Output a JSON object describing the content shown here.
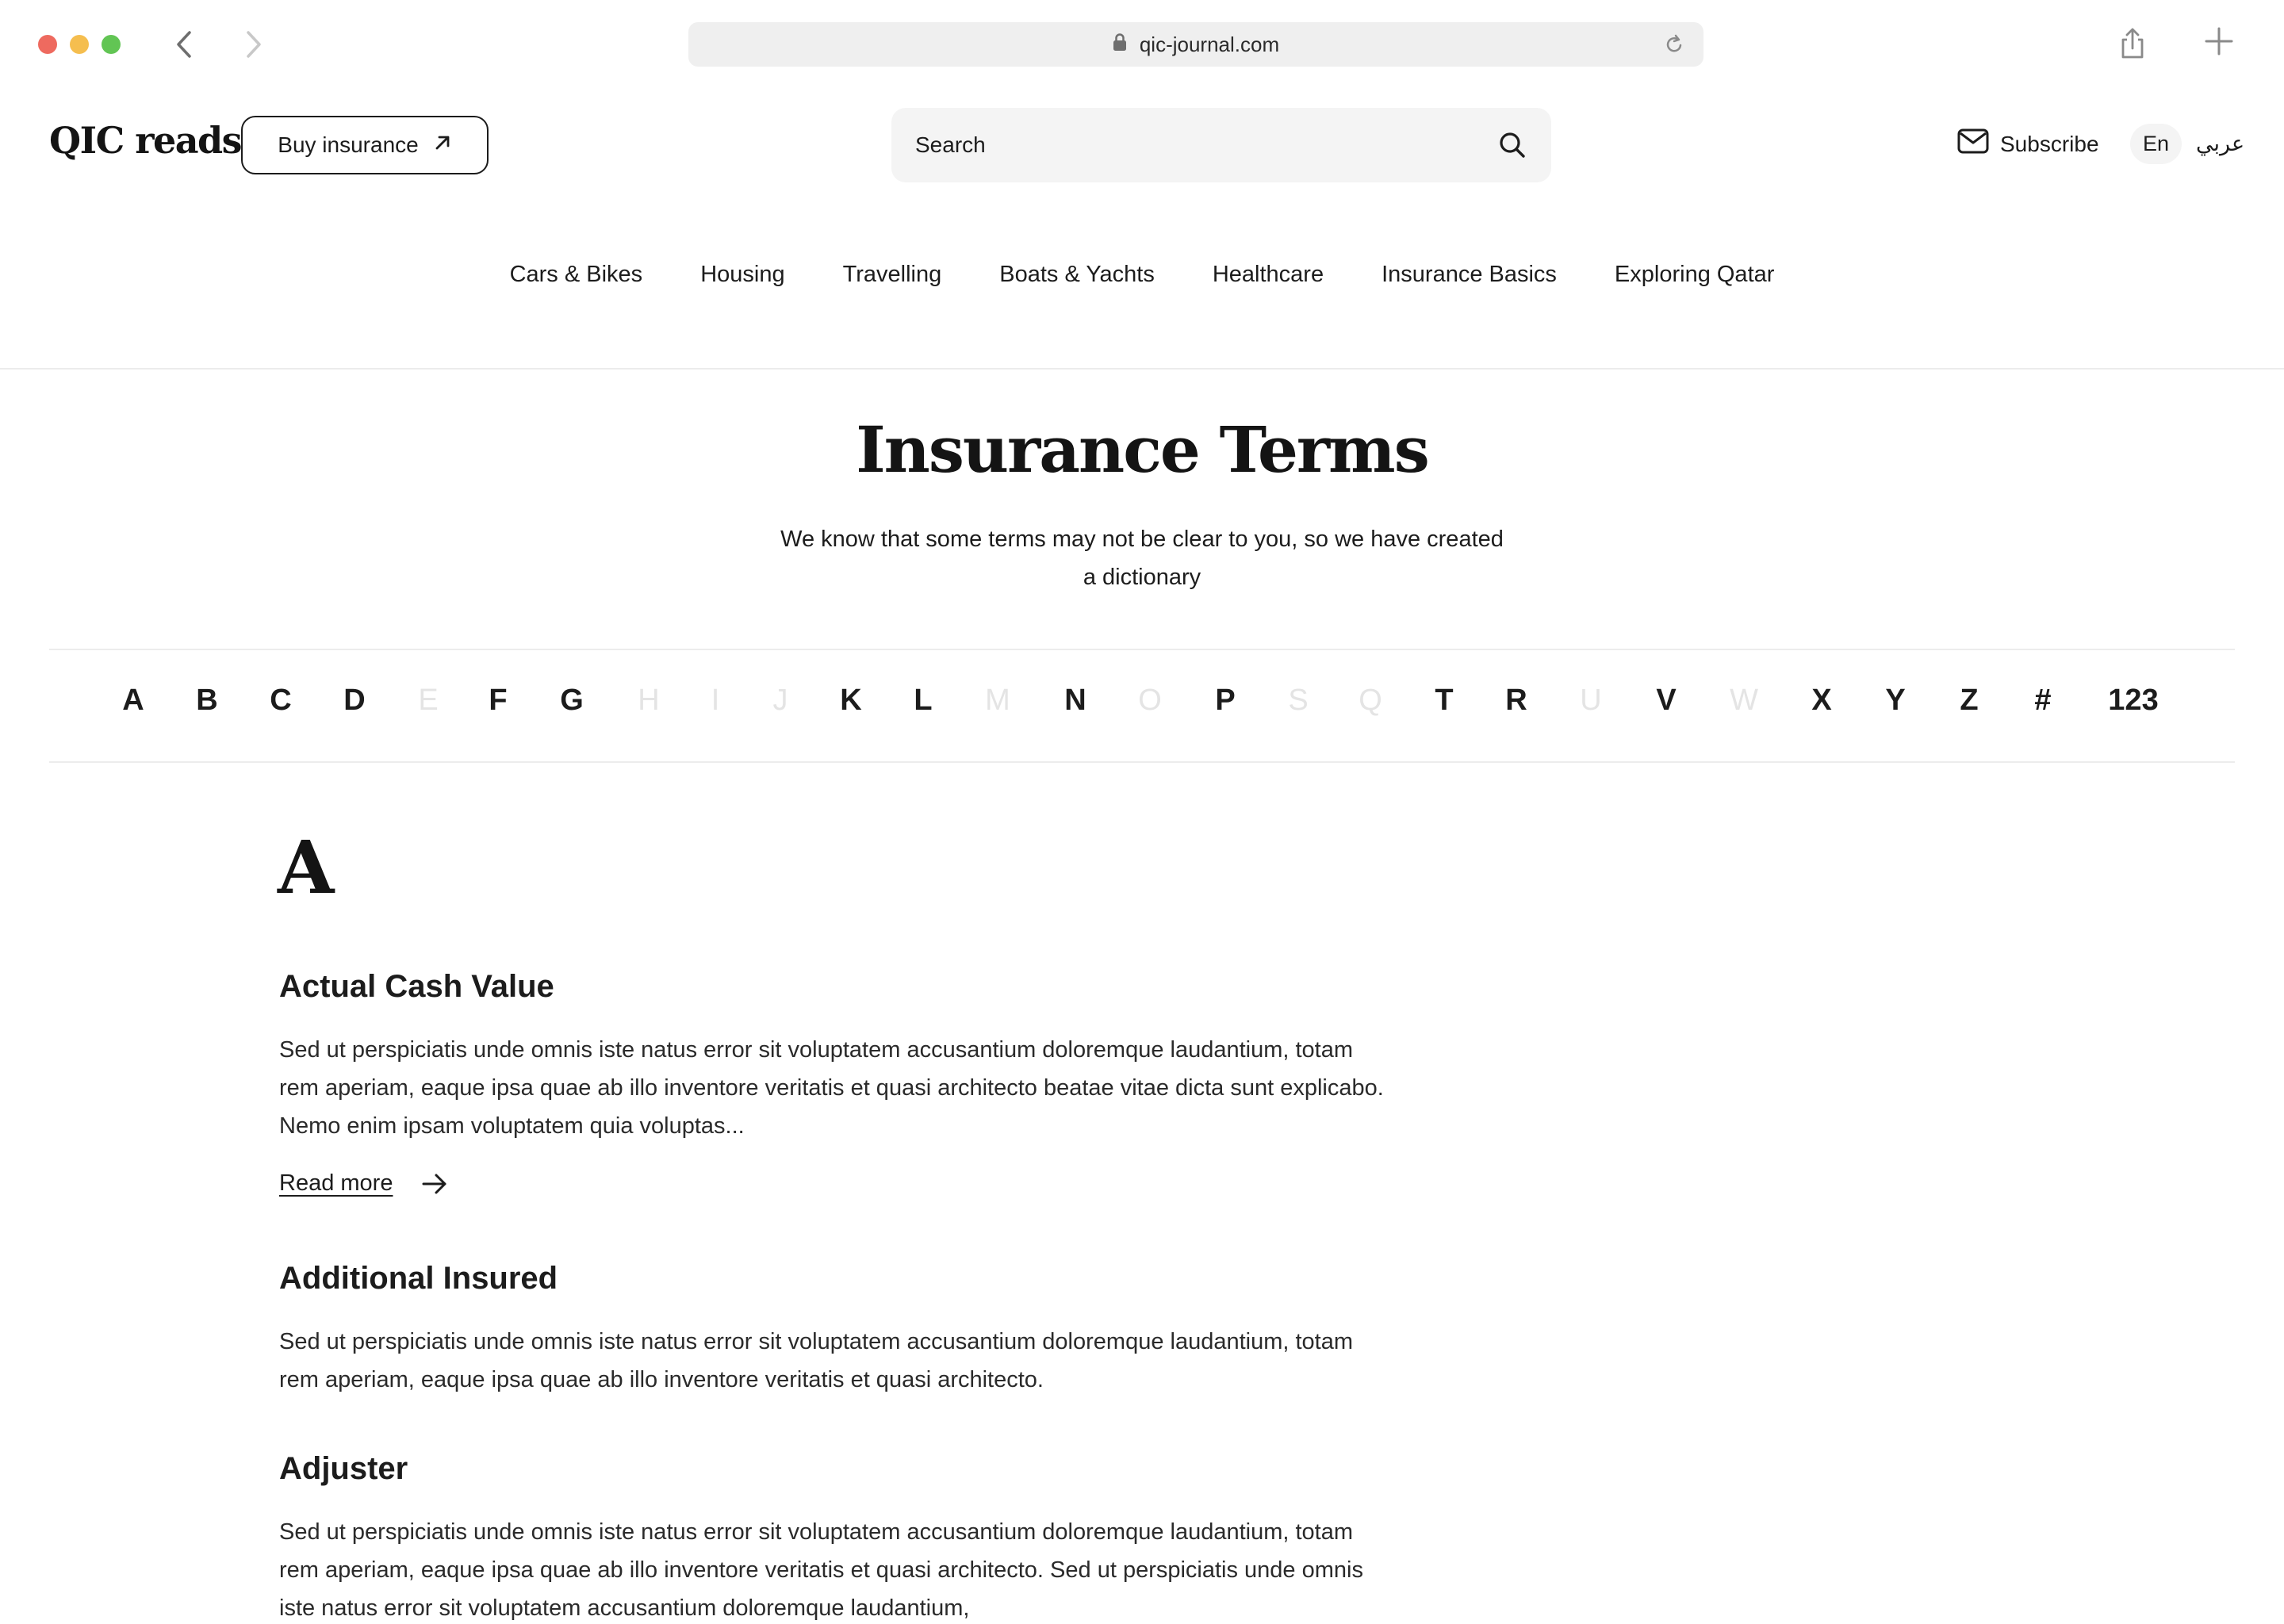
{
  "browser": {
    "url": "qic-journal.com",
    "icons": {
      "back": "chevron-left-icon",
      "forward": "chevron-right-icon",
      "lock": "lock-icon",
      "reload": "reload-icon",
      "share": "share-icon",
      "new_tab": "plus-icon"
    }
  },
  "header": {
    "logo": "QIC reads",
    "buy_label": "Buy insurance",
    "search_placeholder": "Search",
    "subscribe_label": "Subscribe",
    "lang_en": "En",
    "lang_ar": "عربي"
  },
  "nav": {
    "items": [
      "Cars & Bikes",
      "Housing",
      "Travelling",
      "Boats & Yachts",
      "Healthcare",
      "Insurance Basics",
      "Exploring Qatar"
    ]
  },
  "hero": {
    "title": "Insurance Terms",
    "subtitle": "We know that some terms may not be clear to you, so we have created a dictionary"
  },
  "alphabet": [
    {
      "label": "A",
      "enabled": true
    },
    {
      "label": "B",
      "enabled": true
    },
    {
      "label": "C",
      "enabled": true
    },
    {
      "label": "D",
      "enabled": true
    },
    {
      "label": "E",
      "enabled": false
    },
    {
      "label": "F",
      "enabled": true
    },
    {
      "label": "G",
      "enabled": true
    },
    {
      "label": "H",
      "enabled": false
    },
    {
      "label": "I",
      "enabled": false
    },
    {
      "label": "J",
      "enabled": false
    },
    {
      "label": "K",
      "enabled": true
    },
    {
      "label": "L",
      "enabled": true
    },
    {
      "label": "M",
      "enabled": false
    },
    {
      "label": "N",
      "enabled": true
    },
    {
      "label": "O",
      "enabled": false
    },
    {
      "label": "P",
      "enabled": true
    },
    {
      "label": "S",
      "enabled": false
    },
    {
      "label": "Q",
      "enabled": false
    },
    {
      "label": "T",
      "enabled": true
    },
    {
      "label": "R",
      "enabled": true
    },
    {
      "label": "U",
      "enabled": false
    },
    {
      "label": "V",
      "enabled": true
    },
    {
      "label": "W",
      "enabled": false
    },
    {
      "label": "X",
      "enabled": true
    },
    {
      "label": "Y",
      "enabled": true
    },
    {
      "label": "Z",
      "enabled": true
    },
    {
      "label": "#",
      "enabled": true
    },
    {
      "label": "123",
      "enabled": true
    }
  ],
  "section": {
    "letter": "A",
    "terms": [
      {
        "title": "Actual Cash Value",
        "body": "Sed ut perspiciatis unde omnis iste natus error sit voluptatem accusantium doloremque laudantium, totam rem aperiam, eaque ipsa quae ab illo inventore veritatis et quasi architecto beatae vitae dicta sunt explicabo. Nemo enim ipsam voluptatem quia voluptas...",
        "read_more": "Read more"
      },
      {
        "title": "Additional Insured",
        "body": "Sed ut perspiciatis unde omnis iste natus error sit voluptatem accusantium doloremque laudantium, totam rem aperiam, eaque ipsa quae ab illo inventore veritatis et quasi architecto."
      },
      {
        "title": "Adjuster",
        "body": "Sed ut perspiciatis unde omnis iste natus error sit voluptatem accusantium doloremque laudantium, totam rem aperiam, eaque ipsa quae ab illo inventore veritatis et quasi architecto. Sed ut perspiciatis unde omnis iste natus error sit voluptatem accusantium doloremque laudantium,"
      }
    ]
  }
}
